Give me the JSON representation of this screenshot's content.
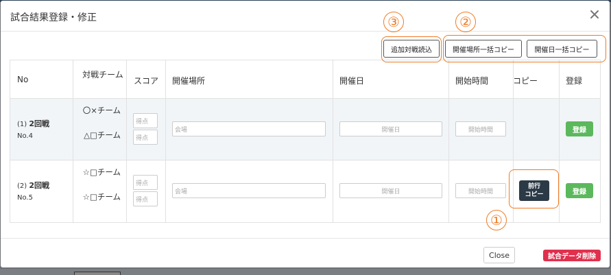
{
  "modal": {
    "title": "試合結果登録・修正"
  },
  "toolbar": {
    "add_match_label": "追加対戦読込",
    "venue_bulk_copy_label": "開催場所一括コピー",
    "date_bulk_copy_label": "開催日一括コピー"
  },
  "annotations": [
    "①",
    "②",
    "③"
  ],
  "table": {
    "headers": [
      "No",
      "対戦チーム",
      "スコア",
      "開催場所",
      "開催日",
      "開始時間",
      "コピー",
      "登録"
    ],
    "rows": [
      {
        "index": "(1)",
        "round": "2回戦",
        "no": "No.4",
        "team1": "〇×チーム",
        "team2": "△□チーム",
        "score_placeholder": "得点",
        "venue_placeholder": "会場",
        "date_placeholder": "開催日",
        "time_placeholder": "開始時間",
        "copy_label": "",
        "register_label": "登録"
      },
      {
        "index": "(2)",
        "round": "2回戦",
        "no": "No.5",
        "team1": "☆□チーム",
        "team2": "☆□チーム",
        "score_placeholder": "得点",
        "venue_placeholder": "会場",
        "date_placeholder": "開催日",
        "time_placeholder": "開始時間",
        "copy_label": "前行コピー",
        "register_label": "登録"
      }
    ]
  },
  "footer": {
    "close_label": "Close",
    "delete_label": "試合データ削除"
  },
  "colors": {
    "accent_annotation": "#f07a24",
    "register_button": "#5cb85c",
    "delete_button": "#e0304e",
    "copy_button": "#2b3a46"
  }
}
